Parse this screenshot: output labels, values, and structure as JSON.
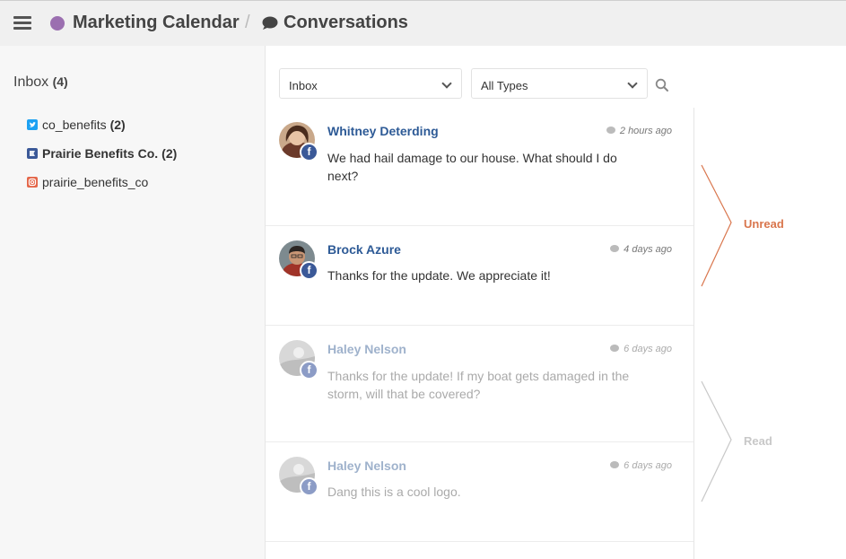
{
  "header": {
    "calendar_name": "Marketing Calendar",
    "separator": "/",
    "page_title": "Conversations",
    "calendar_color": "#9b6fb0"
  },
  "sidebar": {
    "inbox_label": "Inbox",
    "inbox_count": "(4)",
    "accounts": [
      {
        "name": "co_benefits",
        "count": "(2)",
        "icon": "twitter-icon",
        "color": "#1da1f2"
      },
      {
        "name": "Prairie Benefits Co.",
        "count": "(2)",
        "icon": "facebook-page-icon",
        "color": "#3b5998"
      },
      {
        "name": "prairie_benefits_co",
        "count": "",
        "icon": "instagram-icon",
        "color": "#e1306c"
      }
    ]
  },
  "filters": {
    "folder": "Inbox",
    "type": "All Types"
  },
  "conversations": [
    {
      "sender": "Whitney Deterding",
      "time": "2 hours ago",
      "message": "We had hail damage to our house. What should I do next?",
      "status": "unread",
      "network": "f"
    },
    {
      "sender": "Brock Azure",
      "time": "4 days ago",
      "message": "Thanks for the update. We appreciate it!",
      "status": "unread",
      "network": "f"
    },
    {
      "sender": "Haley Nelson",
      "time": "6 days ago",
      "message": "Thanks for the update! If my boat gets damaged in the storm, will that be covered?",
      "status": "read",
      "network": "f"
    },
    {
      "sender": "Haley Nelson",
      "time": "6 days ago",
      "message": "Dang this is a cool logo.",
      "status": "read",
      "network": "f"
    }
  ],
  "annotations": {
    "unread_label": "Unread",
    "read_label": "Read",
    "unread_color": "#d9764d",
    "read_color": "#c8c8c8"
  }
}
